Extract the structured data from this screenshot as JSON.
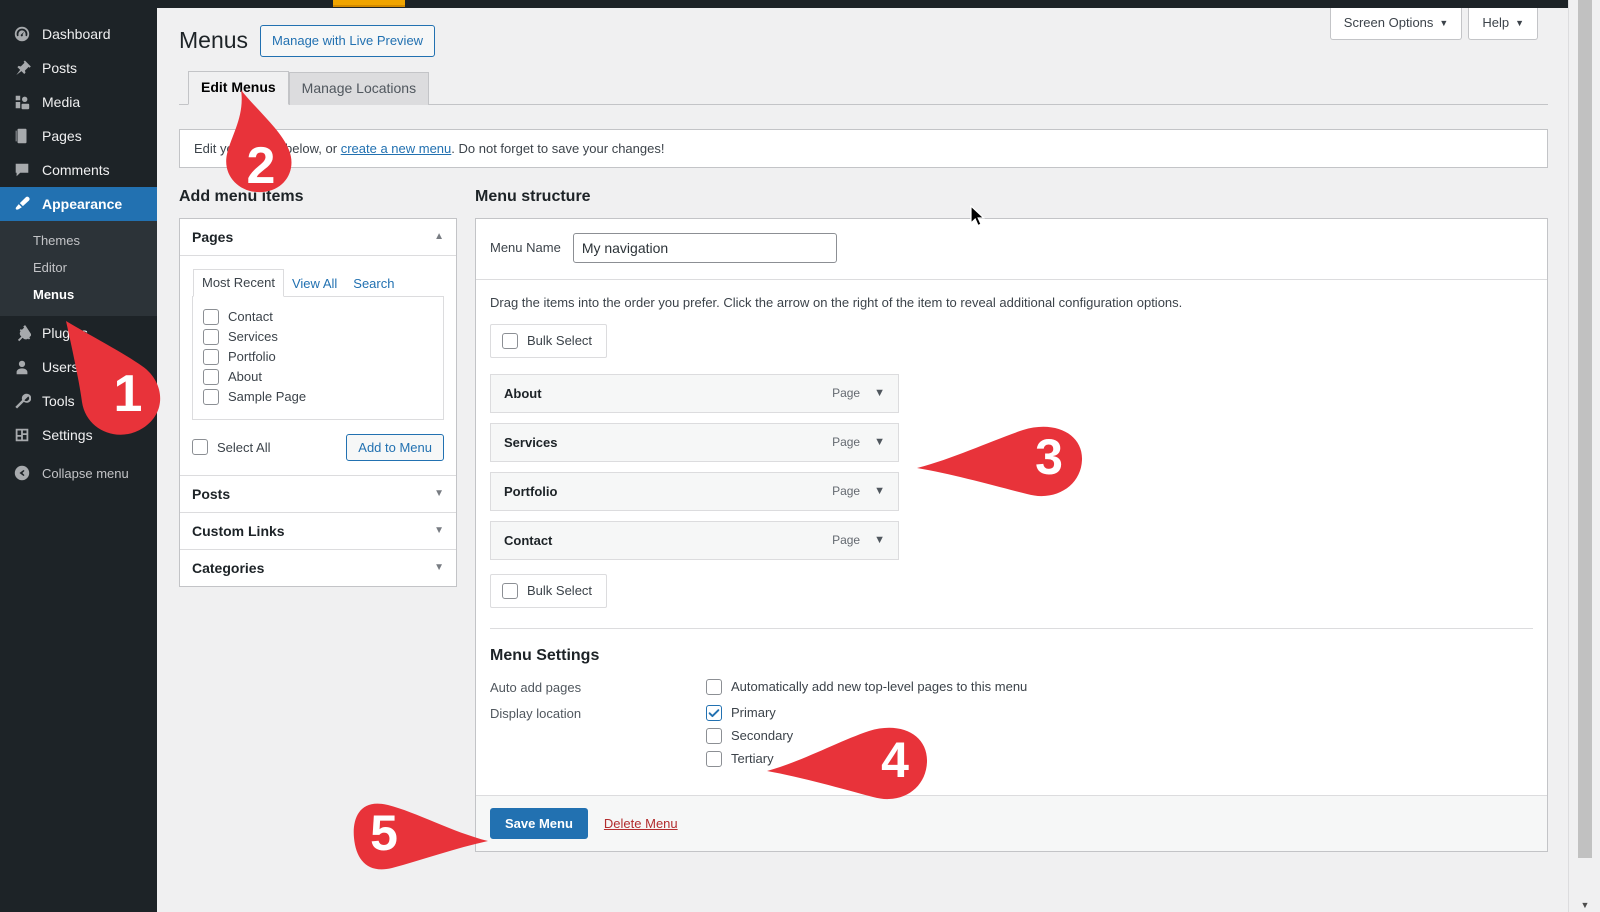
{
  "sidebar": {
    "items": [
      {
        "label": "Dashboard",
        "icon": "dashboard-icon"
      },
      {
        "label": "Posts",
        "icon": "pin-icon"
      },
      {
        "label": "Media",
        "icon": "media-icon"
      },
      {
        "label": "Pages",
        "icon": "page-icon"
      },
      {
        "label": "Comments",
        "icon": "comment-icon"
      },
      {
        "label": "Appearance",
        "icon": "brush-icon",
        "current": true
      },
      {
        "label": "Plugins",
        "icon": "plugin-icon"
      },
      {
        "label": "Users",
        "icon": "user-icon"
      },
      {
        "label": "Tools",
        "icon": "wrench-icon"
      },
      {
        "label": "Settings",
        "icon": "settings-icon"
      }
    ],
    "submenu": [
      {
        "label": "Themes"
      },
      {
        "label": "Editor"
      },
      {
        "label": "Menus",
        "current": true
      }
    ],
    "collapse": {
      "label": "Collapse menu",
      "icon": "collapse-icon"
    }
  },
  "screen_meta": {
    "screen_options": "Screen Options",
    "help": "Help",
    "caret": "▼"
  },
  "header": {
    "title": "Menus",
    "live_preview_button": "Manage with Live Preview"
  },
  "tabs": [
    {
      "label": "Edit Menus",
      "active": true
    },
    {
      "label": "Manage Locations",
      "active": false
    }
  ],
  "notice": {
    "before": "Edit your menu below, or ",
    "link": "create a new menu",
    "after": ". Do not forget to save your changes!"
  },
  "add_menu_items": {
    "title": "Add menu items",
    "pages_panel": {
      "header": "Pages",
      "caret": "▲",
      "tabs": [
        {
          "label": "Most Recent",
          "active": true
        },
        {
          "label": "View All",
          "active": false
        },
        {
          "label": "Search",
          "active": false
        }
      ],
      "pages": [
        {
          "label": "Contact",
          "checked": false
        },
        {
          "label": "Services",
          "checked": false
        },
        {
          "label": "Portfolio",
          "checked": false
        },
        {
          "label": "About",
          "checked": false
        },
        {
          "label": "Sample Page",
          "checked": false
        }
      ],
      "select_all": "Select All",
      "add_to_menu": "Add to Menu"
    },
    "other_panels": [
      {
        "header": "Posts",
        "caret": "▼"
      },
      {
        "header": "Custom Links",
        "caret": "▼"
      },
      {
        "header": "Categories",
        "caret": "▼"
      }
    ]
  },
  "menu_structure": {
    "title": "Menu structure",
    "menu_name_label": "Menu Name",
    "menu_name_value": "My navigation",
    "menu_name_placeholder": "Menu Name",
    "drag_help": "Drag the items into the order you prefer. Click the arrow on the right of the item to reveal additional configuration options.",
    "bulk_select_top": "Bulk Select",
    "bulk_select_bottom": "Bulk Select",
    "items": [
      {
        "title": "About",
        "type": "Page",
        "caret": "▼"
      },
      {
        "title": "Services",
        "type": "Page",
        "caret": "▼"
      },
      {
        "title": "Portfolio",
        "type": "Page",
        "caret": "▼"
      },
      {
        "title": "Contact",
        "type": "Page",
        "caret": "▼"
      }
    ]
  },
  "menu_settings": {
    "title": "Menu Settings",
    "auto_add_label": "Auto add pages",
    "auto_add_option": {
      "label": "Automatically add new top-level pages to this menu",
      "checked": false
    },
    "display_location_label": "Display location",
    "locations": [
      {
        "label": "Primary",
        "checked": true
      },
      {
        "label": "Secondary",
        "checked": false
      },
      {
        "label": "Tertiary",
        "checked": false
      }
    ]
  },
  "footer": {
    "save_button": "Save Menu",
    "delete_link": "Delete Menu"
  },
  "annotations": [
    {
      "number": "1"
    },
    {
      "number": "2"
    },
    {
      "number": "3"
    },
    {
      "number": "4"
    },
    {
      "number": "5"
    }
  ],
  "colors": {
    "accent": "#2271b1",
    "sidebar_bg": "#1d2327",
    "submenu_bg": "#2c3338",
    "annotation_red": "#e8333a",
    "delete_red": "#b32d2e",
    "admin_highlight": "#f0a400"
  }
}
